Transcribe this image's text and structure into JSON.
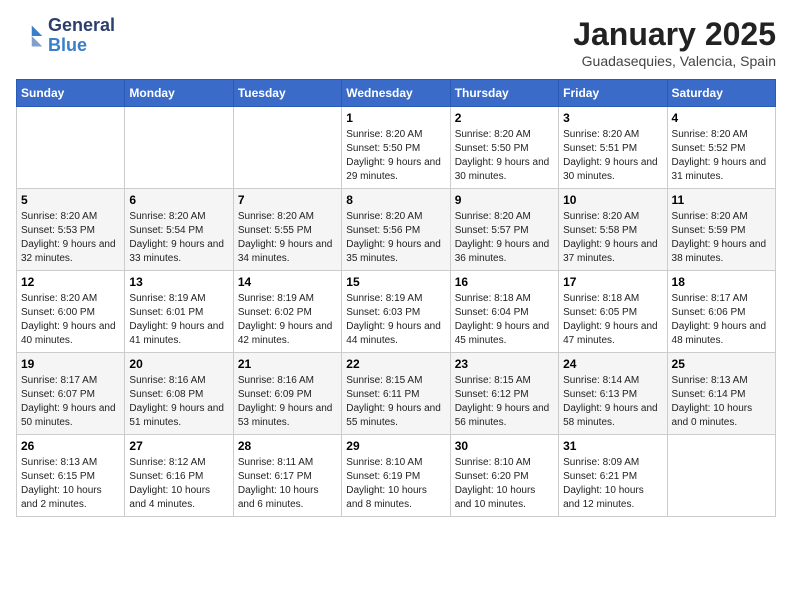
{
  "header": {
    "logo": {
      "general": "General",
      "blue": "Blue"
    },
    "title": "January 2025",
    "location": "Guadasequies, Valencia, Spain"
  },
  "weekdays": [
    "Sunday",
    "Monday",
    "Tuesday",
    "Wednesday",
    "Thursday",
    "Friday",
    "Saturday"
  ],
  "weeks": [
    [
      {
        "day": "",
        "sunrise": "",
        "sunset": "",
        "daylight": ""
      },
      {
        "day": "",
        "sunrise": "",
        "sunset": "",
        "daylight": ""
      },
      {
        "day": "",
        "sunrise": "",
        "sunset": "",
        "daylight": ""
      },
      {
        "day": "1",
        "sunrise": "Sunrise: 8:20 AM",
        "sunset": "Sunset: 5:50 PM",
        "daylight": "Daylight: 9 hours and 29 minutes."
      },
      {
        "day": "2",
        "sunrise": "Sunrise: 8:20 AM",
        "sunset": "Sunset: 5:50 PM",
        "daylight": "Daylight: 9 hours and 30 minutes."
      },
      {
        "day": "3",
        "sunrise": "Sunrise: 8:20 AM",
        "sunset": "Sunset: 5:51 PM",
        "daylight": "Daylight: 9 hours and 30 minutes."
      },
      {
        "day": "4",
        "sunrise": "Sunrise: 8:20 AM",
        "sunset": "Sunset: 5:52 PM",
        "daylight": "Daylight: 9 hours and 31 minutes."
      }
    ],
    [
      {
        "day": "5",
        "sunrise": "Sunrise: 8:20 AM",
        "sunset": "Sunset: 5:53 PM",
        "daylight": "Daylight: 9 hours and 32 minutes."
      },
      {
        "day": "6",
        "sunrise": "Sunrise: 8:20 AM",
        "sunset": "Sunset: 5:54 PM",
        "daylight": "Daylight: 9 hours and 33 minutes."
      },
      {
        "day": "7",
        "sunrise": "Sunrise: 8:20 AM",
        "sunset": "Sunset: 5:55 PM",
        "daylight": "Daylight: 9 hours and 34 minutes."
      },
      {
        "day": "8",
        "sunrise": "Sunrise: 8:20 AM",
        "sunset": "Sunset: 5:56 PM",
        "daylight": "Daylight: 9 hours and 35 minutes."
      },
      {
        "day": "9",
        "sunrise": "Sunrise: 8:20 AM",
        "sunset": "Sunset: 5:57 PM",
        "daylight": "Daylight: 9 hours and 36 minutes."
      },
      {
        "day": "10",
        "sunrise": "Sunrise: 8:20 AM",
        "sunset": "Sunset: 5:58 PM",
        "daylight": "Daylight: 9 hours and 37 minutes."
      },
      {
        "day": "11",
        "sunrise": "Sunrise: 8:20 AM",
        "sunset": "Sunset: 5:59 PM",
        "daylight": "Daylight: 9 hours and 38 minutes."
      }
    ],
    [
      {
        "day": "12",
        "sunrise": "Sunrise: 8:20 AM",
        "sunset": "Sunset: 6:00 PM",
        "daylight": "Daylight: 9 hours and 40 minutes."
      },
      {
        "day": "13",
        "sunrise": "Sunrise: 8:19 AM",
        "sunset": "Sunset: 6:01 PM",
        "daylight": "Daylight: 9 hours and 41 minutes."
      },
      {
        "day": "14",
        "sunrise": "Sunrise: 8:19 AM",
        "sunset": "Sunset: 6:02 PM",
        "daylight": "Daylight: 9 hours and 42 minutes."
      },
      {
        "day": "15",
        "sunrise": "Sunrise: 8:19 AM",
        "sunset": "Sunset: 6:03 PM",
        "daylight": "Daylight: 9 hours and 44 minutes."
      },
      {
        "day": "16",
        "sunrise": "Sunrise: 8:18 AM",
        "sunset": "Sunset: 6:04 PM",
        "daylight": "Daylight: 9 hours and 45 minutes."
      },
      {
        "day": "17",
        "sunrise": "Sunrise: 8:18 AM",
        "sunset": "Sunset: 6:05 PM",
        "daylight": "Daylight: 9 hours and 47 minutes."
      },
      {
        "day": "18",
        "sunrise": "Sunrise: 8:17 AM",
        "sunset": "Sunset: 6:06 PM",
        "daylight": "Daylight: 9 hours and 48 minutes."
      }
    ],
    [
      {
        "day": "19",
        "sunrise": "Sunrise: 8:17 AM",
        "sunset": "Sunset: 6:07 PM",
        "daylight": "Daylight: 9 hours and 50 minutes."
      },
      {
        "day": "20",
        "sunrise": "Sunrise: 8:16 AM",
        "sunset": "Sunset: 6:08 PM",
        "daylight": "Daylight: 9 hours and 51 minutes."
      },
      {
        "day": "21",
        "sunrise": "Sunrise: 8:16 AM",
        "sunset": "Sunset: 6:09 PM",
        "daylight": "Daylight: 9 hours and 53 minutes."
      },
      {
        "day": "22",
        "sunrise": "Sunrise: 8:15 AM",
        "sunset": "Sunset: 6:11 PM",
        "daylight": "Daylight: 9 hours and 55 minutes."
      },
      {
        "day": "23",
        "sunrise": "Sunrise: 8:15 AM",
        "sunset": "Sunset: 6:12 PM",
        "daylight": "Daylight: 9 hours and 56 minutes."
      },
      {
        "day": "24",
        "sunrise": "Sunrise: 8:14 AM",
        "sunset": "Sunset: 6:13 PM",
        "daylight": "Daylight: 9 hours and 58 minutes."
      },
      {
        "day": "25",
        "sunrise": "Sunrise: 8:13 AM",
        "sunset": "Sunset: 6:14 PM",
        "daylight": "Daylight: 10 hours and 0 minutes."
      }
    ],
    [
      {
        "day": "26",
        "sunrise": "Sunrise: 8:13 AM",
        "sunset": "Sunset: 6:15 PM",
        "daylight": "Daylight: 10 hours and 2 minutes."
      },
      {
        "day": "27",
        "sunrise": "Sunrise: 8:12 AM",
        "sunset": "Sunset: 6:16 PM",
        "daylight": "Daylight: 10 hours and 4 minutes."
      },
      {
        "day": "28",
        "sunrise": "Sunrise: 8:11 AM",
        "sunset": "Sunset: 6:17 PM",
        "daylight": "Daylight: 10 hours and 6 minutes."
      },
      {
        "day": "29",
        "sunrise": "Sunrise: 8:10 AM",
        "sunset": "Sunset: 6:19 PM",
        "daylight": "Daylight: 10 hours and 8 minutes."
      },
      {
        "day": "30",
        "sunrise": "Sunrise: 8:10 AM",
        "sunset": "Sunset: 6:20 PM",
        "daylight": "Daylight: 10 hours and 10 minutes."
      },
      {
        "day": "31",
        "sunrise": "Sunrise: 8:09 AM",
        "sunset": "Sunset: 6:21 PM",
        "daylight": "Daylight: 10 hours and 12 minutes."
      },
      {
        "day": "",
        "sunrise": "",
        "sunset": "",
        "daylight": ""
      }
    ]
  ]
}
